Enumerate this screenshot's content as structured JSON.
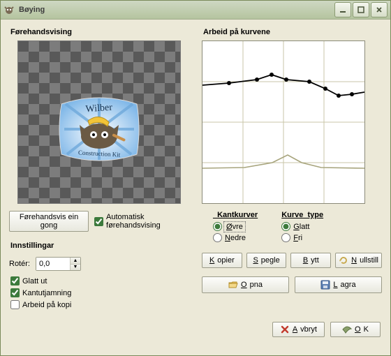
{
  "window": {
    "title": "Bøying"
  },
  "preview": {
    "title": "Førehandsvising",
    "once_button": "Førehandsvis ein gong",
    "auto_checkbox": "Automatisk førehandsvising",
    "auto_checked": true,
    "logo_top": "Wilber",
    "logo_bottom": "Construction Kit"
  },
  "settings": {
    "title": "Innstillingar",
    "rotate_label": "Rotér:",
    "rotate_value": "0,0",
    "smooth_label": "Glatt ut",
    "smooth_checked": true,
    "antialias_label": "Kantutjamning",
    "antialias_checked": true,
    "work_on_copy_label": "Arbeid på kopi",
    "work_on_copy_checked": false
  },
  "curves": {
    "title": "Arbeid på kurvene",
    "edge_title": "_Kantkurver",
    "edge_upper": "Øvre",
    "edge_lower": "Nedre",
    "type_title": "Kurve_type",
    "type_smooth": "Glatt",
    "type_free": "Fri",
    "btn_copy": "Kopier",
    "btn_mirror": "Spegle",
    "btn_swap": "Bytt",
    "btn_reset": "Nullstill",
    "btn_open": "Opna",
    "btn_save": "Lagra"
  },
  "footer": {
    "cancel": "Avbryt",
    "ok": "OK"
  },
  "chart_data": {
    "type": "line",
    "title": "Arbeid på kurvene",
    "xlim": [
      0,
      232
    ],
    "ylim": [
      0,
      232
    ],
    "grid": true,
    "series": [
      {
        "name": "upper",
        "color": "#000000",
        "points": [
          {
            "x": 0,
            "y": 63
          },
          {
            "x": 38,
            "y": 60
          },
          {
            "x": 78,
            "y": 55
          },
          {
            "x": 99,
            "y": 48
          },
          {
            "x": 120,
            "y": 55
          },
          {
            "x": 153,
            "y": 58
          },
          {
            "x": 176,
            "y": 68
          },
          {
            "x": 195,
            "y": 78
          },
          {
            "x": 214,
            "y": 76
          },
          {
            "x": 232,
            "y": 73
          }
        ]
      },
      {
        "name": "lower",
        "color": "#a7a47c",
        "points": [
          {
            "x": 0,
            "y": 182
          },
          {
            "x": 60,
            "y": 181
          },
          {
            "x": 100,
            "y": 174
          },
          {
            "x": 122,
            "y": 163
          },
          {
            "x": 142,
            "y": 174
          },
          {
            "x": 170,
            "y": 181
          },
          {
            "x": 232,
            "y": 182
          }
        ]
      }
    ]
  }
}
